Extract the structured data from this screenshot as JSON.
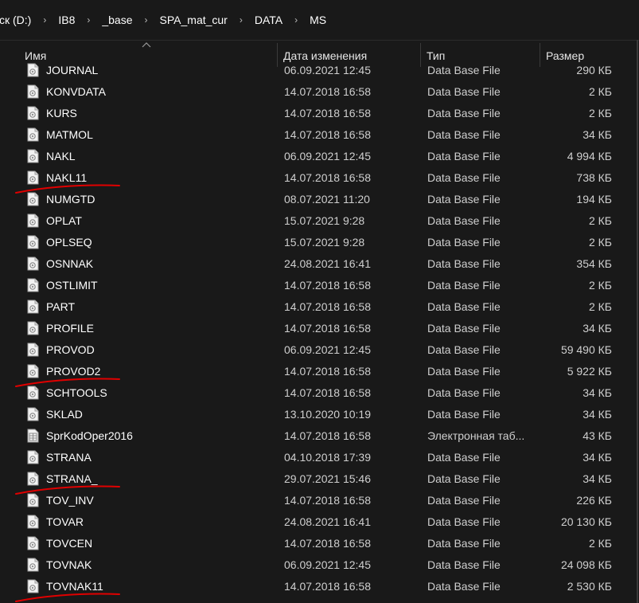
{
  "breadcrumb": [
    "ск (D:)",
    "IB8",
    "_base",
    "SPA_mat_cur",
    "DATA",
    "MS"
  ],
  "headers": {
    "name": "Имя",
    "date": "Дата изменения",
    "type": "Тип",
    "size": "Размер"
  },
  "rows": [
    {
      "name": "JOURNAL",
      "date": "06.09.2021 12:45",
      "type": "Data Base File",
      "size": "290 КБ",
      "icon": "db-file-icon"
    },
    {
      "name": "KONVDATA",
      "date": "14.07.2018 16:58",
      "type": "Data Base File",
      "size": "2 КБ",
      "icon": "db-file-icon"
    },
    {
      "name": "KURS",
      "date": "14.07.2018 16:58",
      "type": "Data Base File",
      "size": "2 КБ",
      "icon": "db-file-icon"
    },
    {
      "name": "MATMOL",
      "date": "14.07.2018 16:58",
      "type": "Data Base File",
      "size": "34 КБ",
      "icon": "db-file-icon"
    },
    {
      "name": "NAKL",
      "date": "06.09.2021 12:45",
      "type": "Data Base File",
      "size": "4 994 КБ",
      "icon": "db-file-icon"
    },
    {
      "name": "NAKL11",
      "date": "14.07.2018 16:58",
      "type": "Data Base File",
      "size": "738 КБ",
      "icon": "db-file-icon"
    },
    {
      "name": "NUMGTD",
      "date": "08.07.2021 11:20",
      "type": "Data Base File",
      "size": "194 КБ",
      "icon": "db-file-icon"
    },
    {
      "name": "OPLAT",
      "date": "15.07.2021 9:28",
      "type": "Data Base File",
      "size": "2 КБ",
      "icon": "db-file-icon"
    },
    {
      "name": "OPLSEQ",
      "date": "15.07.2021 9:28",
      "type": "Data Base File",
      "size": "2 КБ",
      "icon": "db-file-icon"
    },
    {
      "name": "OSNNAK",
      "date": "24.08.2021 16:41",
      "type": "Data Base File",
      "size": "354 КБ",
      "icon": "db-file-icon"
    },
    {
      "name": "OSTLIMIT",
      "date": "14.07.2018 16:58",
      "type": "Data Base File",
      "size": "2 КБ",
      "icon": "db-file-icon"
    },
    {
      "name": "PART",
      "date": "14.07.2018 16:58",
      "type": "Data Base File",
      "size": "2 КБ",
      "icon": "db-file-icon"
    },
    {
      "name": "PROFILE",
      "date": "14.07.2018 16:58",
      "type": "Data Base File",
      "size": "34 КБ",
      "icon": "db-file-icon"
    },
    {
      "name": "PROVOD",
      "date": "06.09.2021 12:45",
      "type": "Data Base File",
      "size": "59 490 КБ",
      "icon": "db-file-icon"
    },
    {
      "name": "PROVOD2",
      "date": "14.07.2018 16:58",
      "type": "Data Base File",
      "size": "5 922 КБ",
      "icon": "db-file-icon"
    },
    {
      "name": "SCHTOOLS",
      "date": "14.07.2018 16:58",
      "type": "Data Base File",
      "size": "34 КБ",
      "icon": "db-file-icon"
    },
    {
      "name": "SKLAD",
      "date": "13.10.2020 10:19",
      "type": "Data Base File",
      "size": "34 КБ",
      "icon": "db-file-icon"
    },
    {
      "name": "SprKodOper2016",
      "date": "14.07.2018 16:58",
      "type": "Электронная таб...",
      "size": "43 КБ",
      "icon": "spreadsheet-icon"
    },
    {
      "name": "STRANA",
      "date": "04.10.2018 17:39",
      "type": "Data Base File",
      "size": "34 КБ",
      "icon": "db-file-icon"
    },
    {
      "name": "STRANA_",
      "date": "29.07.2021 15:46",
      "type": "Data Base File",
      "size": "34 КБ",
      "icon": "db-file-icon"
    },
    {
      "name": "TOV_INV",
      "date": "14.07.2018 16:58",
      "type": "Data Base File",
      "size": "226 КБ",
      "icon": "db-file-icon"
    },
    {
      "name": "TOVAR",
      "date": "24.08.2021 16:41",
      "type": "Data Base File",
      "size": "20 130 КБ",
      "icon": "db-file-icon"
    },
    {
      "name": "TOVCEN",
      "date": "14.07.2018 16:58",
      "type": "Data Base File",
      "size": "2 КБ",
      "icon": "db-file-icon"
    },
    {
      "name": "TOVNAK",
      "date": "06.09.2021 12:45",
      "type": "Data Base File",
      "size": "24 098 КБ",
      "icon": "db-file-icon"
    },
    {
      "name": "TOVNAK11",
      "date": "14.07.2018 16:58",
      "type": "Data Base File",
      "size": "2 530 КБ",
      "icon": "db-file-icon"
    }
  ],
  "annotations": {
    "color": "#e00000",
    "underlined": [
      "NAKL11",
      "PROVOD2",
      "STRANA_",
      "TOVNAK11"
    ]
  },
  "colors": {
    "background": "#191919",
    "text": "#ffffff",
    "muted": "#cfcfcf"
  }
}
